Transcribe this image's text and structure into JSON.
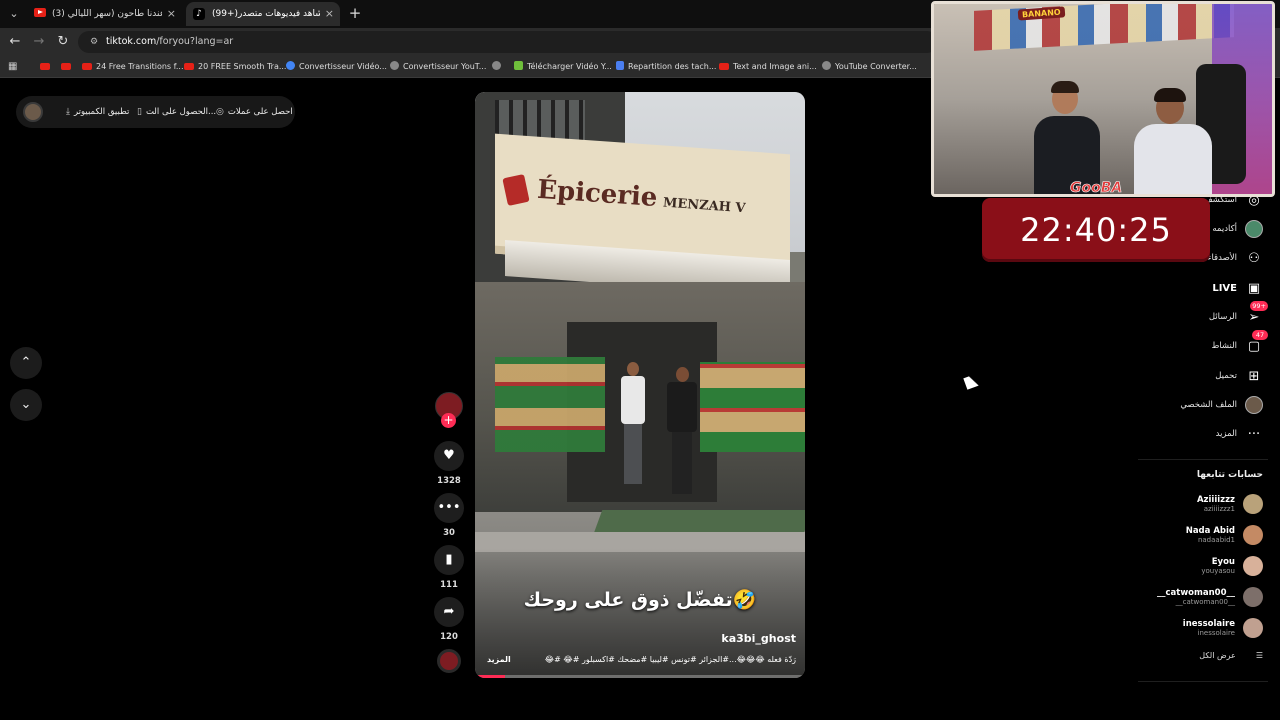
{
  "browser": {
    "tabs": [
      {
        "title": "(3) كان عندنا طاحون (سهر الليالي",
        "close": "×"
      },
      {
        "title": "(99+)شاهد فيديوهات متصدر",
        "close": "×"
      }
    ],
    "new_tab": "+",
    "url_domain": "tiktok.com",
    "url_path": "/foryou?lang=ar",
    "bookmarks": [
      "24 Free Transitions f...",
      "20 FREE Smooth Tra...",
      "Convertisseur Vidéo...",
      "Convertisseur YouT...",
      "Télécharger Vidéo Y...",
      "Repartition des tach...",
      "Text and Image ani...",
      "YouTube Converter..."
    ]
  },
  "top_bar": {
    "get_coins": "احصل على عملات",
    "get_app": "الحصول على الت...",
    "desktop_app": "تطبيق الكمبيوتر"
  },
  "video": {
    "sign_text": "Épicerie",
    "sign_sub": "MENZAH V",
    "caption": "تفضّل ذوق على روحك🤣",
    "author": "ka3bi_ghost",
    "description": "رَدّة فعله 😂😂😂...#الجزائر #تونس #ليبيا #مضحك #اكسبلور #😂 #😂",
    "more": "المزيد",
    "progress": 0.09
  },
  "actions": {
    "likes": "1328",
    "comments": "30",
    "saves": "111",
    "shares": "120"
  },
  "overlay": {
    "clock": "22:40:25",
    "cam_logo": "GooBA",
    "cam_banner": "BANANO"
  },
  "sidebar": {
    "items": [
      {
        "label": "استكشف",
        "icon": "compass-icon"
      },
      {
        "label": "أكاديمه",
        "icon": "avatar"
      },
      {
        "label": "الأصدقاء",
        "icon": "friends-icon"
      },
      {
        "label": "LIVE",
        "icon": "live-icon"
      },
      {
        "label": "الرسائل",
        "icon": "messages-icon",
        "badge": "99+"
      },
      {
        "label": "النشاط",
        "icon": "activity-icon",
        "badge": "47"
      },
      {
        "label": "تحميل",
        "icon": "upload-icon"
      },
      {
        "label": "الملف الشخصي",
        "icon": "profile-avatar"
      },
      {
        "label": "المزيد",
        "icon": "more-icon"
      }
    ],
    "following_title": "حسابات تتابعها",
    "following": [
      {
        "name": "Aziiiizzz",
        "handle": "aziiiizzz1",
        "color": "#b9a27a"
      },
      {
        "name": "Nada Abid",
        "handle": "nadaabid1",
        "color": "#c48a64"
      },
      {
        "name": "Eyou",
        "handle": "youyasou",
        "color": "#d8b19a"
      },
      {
        "name": "__catwoman00__",
        "handle": "__catwoman00__",
        "color": "#7d6f6a"
      },
      {
        "name": "inessolaire",
        "handle": "inessolaire",
        "color": "#c0a090"
      }
    ],
    "show_all": "عرض الكل"
  },
  "colors": {
    "accent": "#fe2c55",
    "clock_bg": "#8a0f18"
  }
}
